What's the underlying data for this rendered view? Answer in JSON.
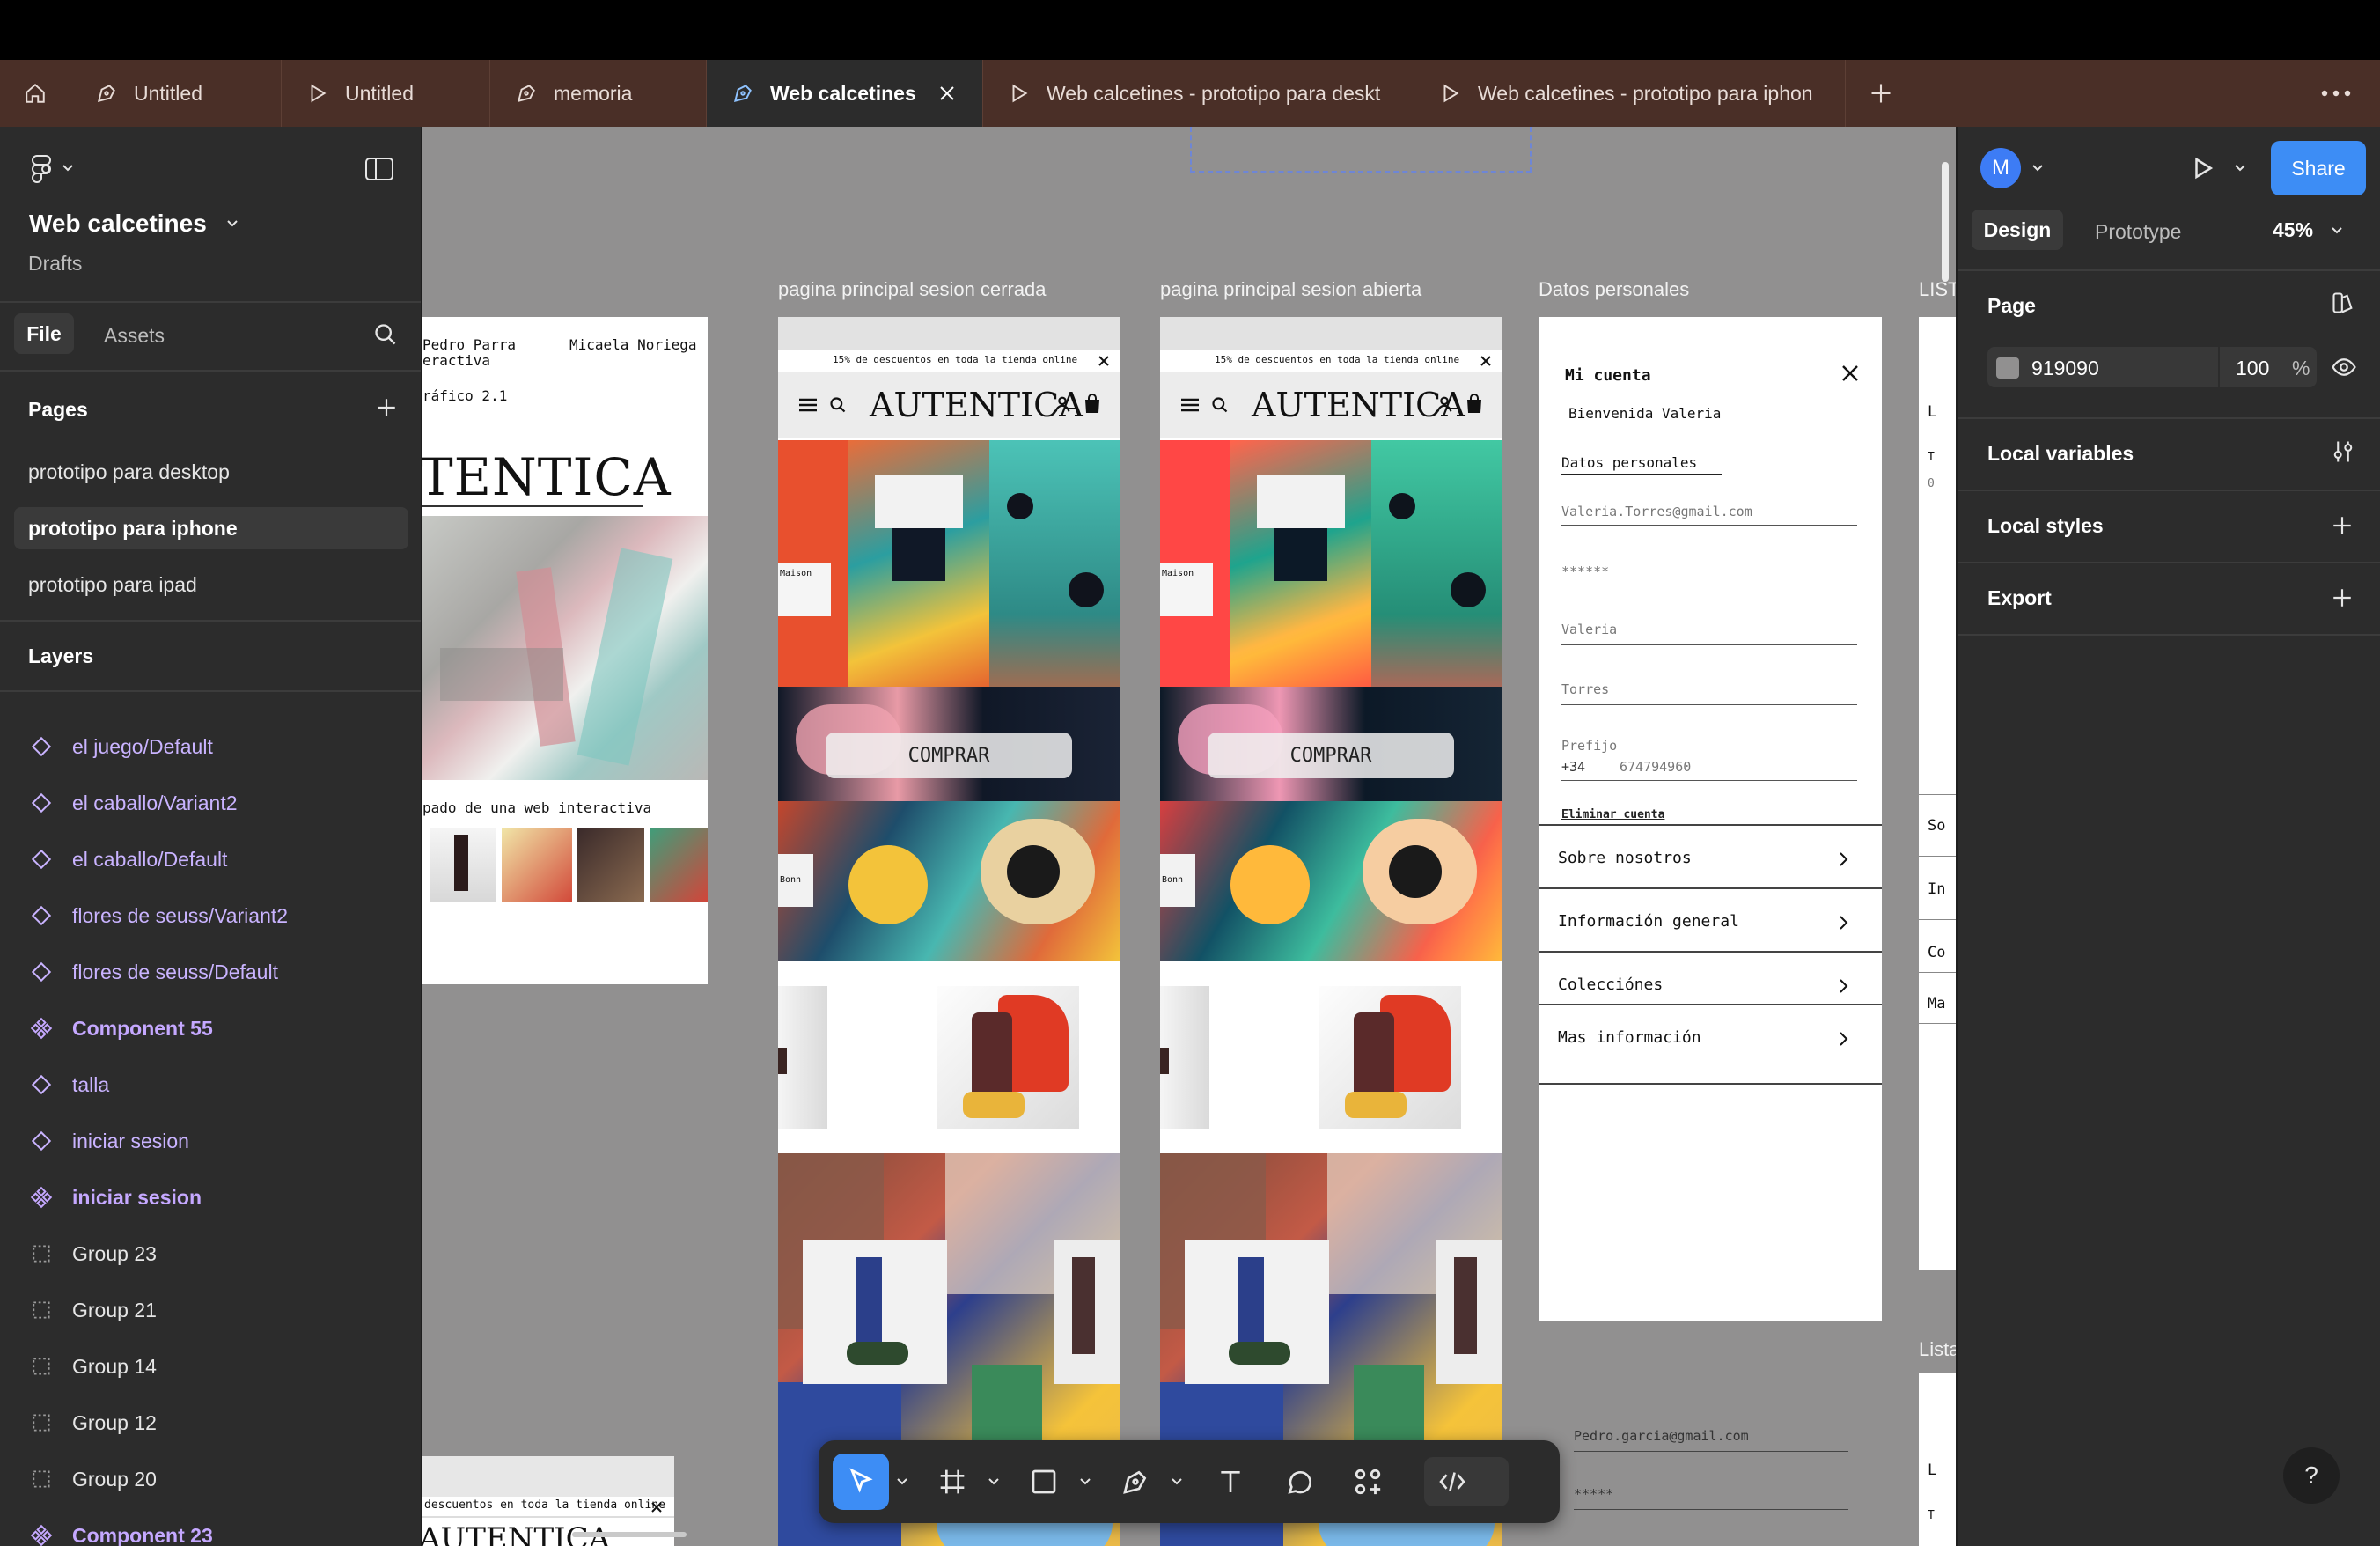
{
  "tabs": [
    {
      "label": "Untitled",
      "kind": "design"
    },
    {
      "label": "Untitled",
      "kind": "prototype"
    },
    {
      "label": "memoria",
      "kind": "design"
    },
    {
      "label": "Web calcetines",
      "kind": "design",
      "active": true
    },
    {
      "label": "Web calcetines - prototipo para deskt",
      "kind": "prototype"
    },
    {
      "label": "Web calcetines - prototipo para iphon",
      "kind": "prototype"
    }
  ],
  "file": {
    "name": "Web calcetines",
    "location": "Drafts"
  },
  "left_tabs": {
    "file": "File",
    "assets": "Assets"
  },
  "pages": {
    "heading": "Pages",
    "items": [
      "prototipo para desktop",
      "prototipo para iphone",
      "prototipo para ipad"
    ],
    "selected_index": 1
  },
  "layers": {
    "heading": "Layers",
    "items": [
      {
        "label": "el juego/Default",
        "type": "instance"
      },
      {
        "label": "el caballo/Variant2",
        "type": "instance"
      },
      {
        "label": "el caballo/Default",
        "type": "instance"
      },
      {
        "label": "flores de seuss/Variant2",
        "type": "instance"
      },
      {
        "label": "flores de seuss/Default",
        "type": "instance"
      },
      {
        "label": "Component 55",
        "type": "component"
      },
      {
        "label": "talla",
        "type": "instance"
      },
      {
        "label": "iniciar sesion",
        "type": "instance"
      },
      {
        "label": "iniciar sesion",
        "type": "component"
      },
      {
        "label": "Group 23",
        "type": "group"
      },
      {
        "label": "Group 21",
        "type": "group"
      },
      {
        "label": "Group 14",
        "type": "group"
      },
      {
        "label": "Group 12",
        "type": "group"
      },
      {
        "label": "Group 20",
        "type": "group"
      },
      {
        "label": "Component 23",
        "type": "component"
      }
    ]
  },
  "canvas": {
    "background": "#919090",
    "frame_labels": [
      "pagina principal sesion cerrada",
      "pagina principal sesion abierta",
      "Datos personales",
      "LIST",
      "Lista"
    ],
    "left_frame": {
      "name_left": "Pedro Parra",
      "name_left_2": "eractiva",
      "name_right": "Micaela Noriega",
      "course": "ráfico 2.1",
      "brand": "TENTICA",
      "caption": "pado de una web interactiva"
    },
    "bottom_frame": {
      "banner": "descuentos en toda la tienda online",
      "brand": "AUTENTICA"
    },
    "phone": {
      "banner": "15% de descuentos en toda la tienda online",
      "brand": "AUTENTICA",
      "cta": "COMPRAR",
      "tag_a": "Maison",
      "tag_b": "Bonn"
    },
    "datos": {
      "title": "Mi cuenta",
      "welcome": "Bienvenida Valeria",
      "section": "Datos personales",
      "email": "Valeria.Torres@gmail.com",
      "password": "******",
      "name": "Valeria",
      "surname": "Torres",
      "prefix_label": "Prefijo",
      "prefix": "+34",
      "phone": "674794960",
      "delete": "Eliminar cuenta",
      "menu": [
        "Sobre nosotros",
        "Información general",
        "Colecciónes",
        "Mas información"
      ]
    },
    "login_preview": {
      "email": "Pedro.garcia@gmail.com",
      "password": "*****"
    },
    "list_frame": {
      "rows": [
        "So",
        "In",
        "Co",
        "Ma"
      ],
      "letter": "L",
      "sub": "T",
      "sub2": "0",
      "letter2": "L",
      "sub3": "T"
    }
  },
  "right": {
    "avatar": "M",
    "share": "Share",
    "tabs": {
      "design": "Design",
      "prototype": "Prototype"
    },
    "zoom": "45%",
    "page": {
      "heading": "Page",
      "color_hex": "919090",
      "opacity": "100",
      "unit": "%"
    },
    "sections": [
      "Local variables",
      "Local styles",
      "Export"
    ]
  },
  "help": "?"
}
